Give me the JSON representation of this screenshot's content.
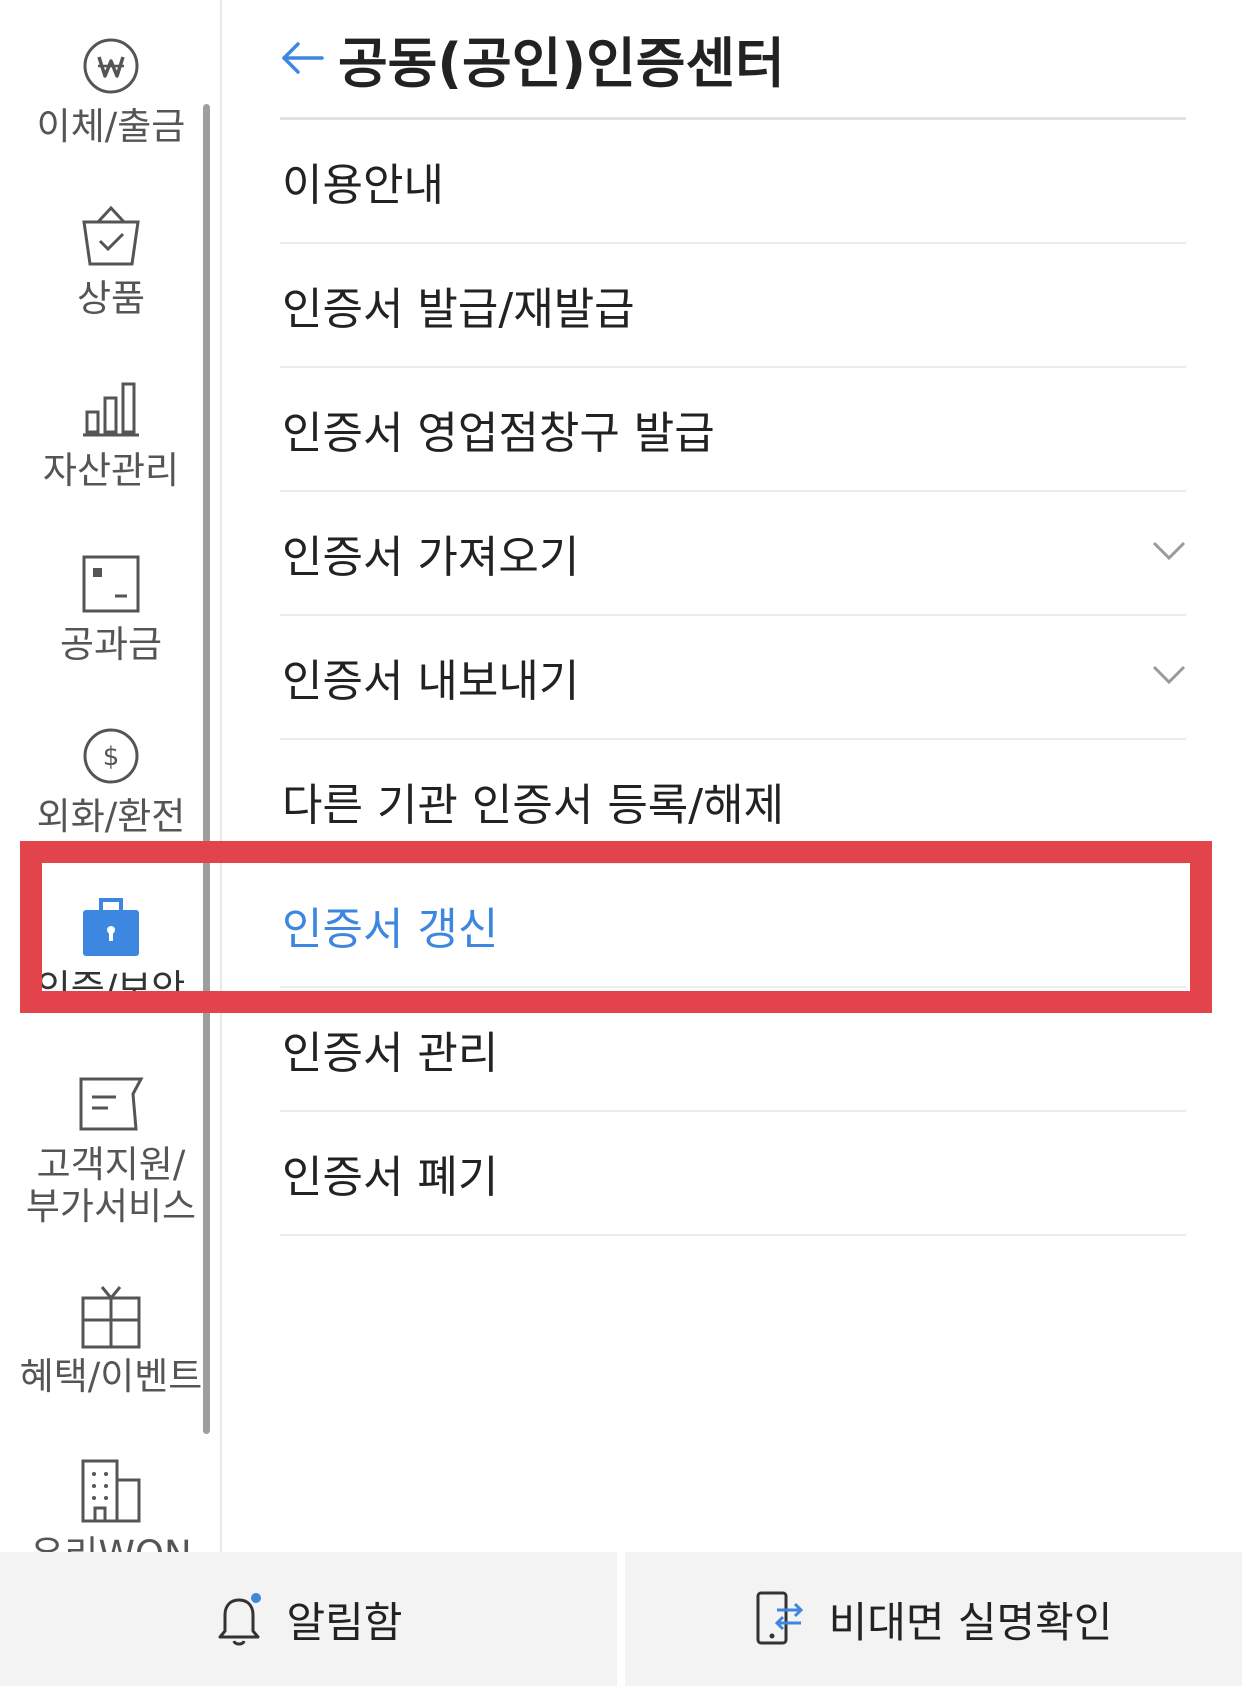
{
  "header": {
    "title": "공동(공인)인증센터"
  },
  "sidebar": {
    "items": [
      {
        "label": "이체/출금",
        "icon": "won-coin-icon"
      },
      {
        "label": "상품",
        "icon": "shopping-bag-icon"
      },
      {
        "label": "자산관리",
        "icon": "bar-chart-icon"
      },
      {
        "label": "공과금",
        "icon": "bill-icon"
      },
      {
        "label": "외화/환전",
        "icon": "dollar-coin-icon"
      },
      {
        "label": "인증/보안",
        "icon": "lock-case-icon",
        "active": true
      },
      {
        "label_line1": "고객지원/",
        "label_line2": "부가서비스",
        "icon": "chat-note-icon"
      },
      {
        "label": "혜택/이벤트",
        "icon": "gift-icon"
      },
      {
        "label": "우리WON",
        "icon": "building-icon"
      }
    ]
  },
  "menu": {
    "items": [
      {
        "label": "이용안내"
      },
      {
        "label": "인증서 발급/재발급"
      },
      {
        "label": "인증서 영업점창구 발급"
      },
      {
        "label": "인증서 가져오기",
        "expandable": true
      },
      {
        "label": "인증서 내보내기",
        "expandable": true
      },
      {
        "label": "다른 기관 인증서 등록/해제"
      },
      {
        "label": "인증서 갱신",
        "active": true
      },
      {
        "label": "인증서 관리"
      },
      {
        "label": "인증서 폐기"
      }
    ]
  },
  "bottom_bar": {
    "notifications_label": "알림함",
    "verification_label": "비대면 실명확인"
  },
  "colors": {
    "accent": "#3d87e0",
    "highlight": "#e3434b",
    "text": "#222222",
    "muted_text": "#555555",
    "divider": "#ececec"
  }
}
